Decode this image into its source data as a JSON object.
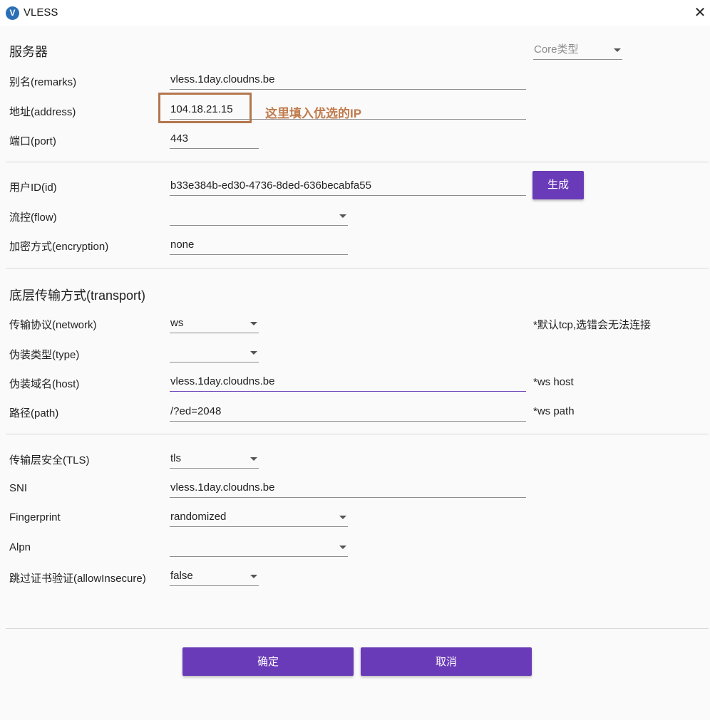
{
  "window": {
    "title": "VLESS",
    "app_icon_letter": "V",
    "close_glyph": "✕"
  },
  "colors": {
    "accent": "#6a3bb8",
    "annotation": "#c07a4c",
    "highlight_border": "#b5764d"
  },
  "server": {
    "section_title": "服务器",
    "core_type": {
      "placeholder": "Core类型"
    },
    "remarks": {
      "label": "别名(remarks)",
      "value": "vless.1day.cloudns.be"
    },
    "address": {
      "label": "地址(address)",
      "value": "104.18.21.15"
    },
    "port": {
      "label": "端口(port)",
      "value": "443"
    }
  },
  "user": {
    "id": {
      "label": "用户ID(id)",
      "value": "b33e384b-ed30-4736-8ded-636becabfa55"
    },
    "generate_label": "生成",
    "flow": {
      "label": "流控(flow)",
      "value": ""
    },
    "encryption": {
      "label": "加密方式(encryption)",
      "value": "none"
    }
  },
  "transport": {
    "section_title": "底层传输方式(transport)",
    "network": {
      "label": "传输协议(network)",
      "value": "ws",
      "hint": "*默认tcp,选错会无法连接"
    },
    "type": {
      "label": "伪装类型(type)",
      "value": ""
    },
    "host": {
      "label": "伪装域名(host)",
      "value": "vless.1day.cloudns.be",
      "hint": "*ws host"
    },
    "path": {
      "label": "路径(path)",
      "value": "/?ed=2048",
      "hint": "*ws path"
    }
  },
  "tls": {
    "security": {
      "label": "传输层安全(TLS)",
      "value": "tls"
    },
    "sni": {
      "label": "SNI",
      "value": "vless.1day.cloudns.be"
    },
    "fingerprint": {
      "label": "Fingerprint",
      "value": "randomized"
    },
    "alpn": {
      "label": "Alpn",
      "value": ""
    },
    "allow_insecure": {
      "label": "跳过证书验证(allowInsecure)",
      "value": "false"
    }
  },
  "annotation": {
    "text": "这里填入优选的IP"
  },
  "footer": {
    "ok_label": "确定",
    "cancel_label": "取消"
  }
}
